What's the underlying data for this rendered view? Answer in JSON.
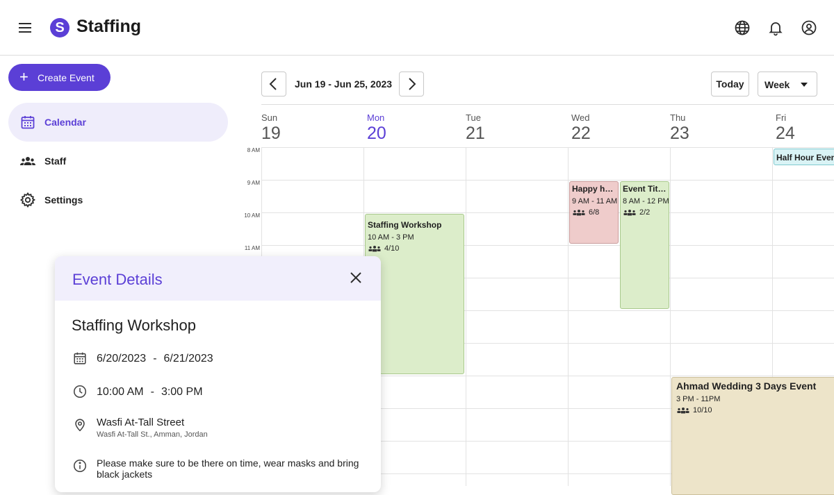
{
  "app": {
    "title": "Staffing",
    "logo_letter": "S"
  },
  "sidebar": {
    "create_label": "Create Event",
    "items": [
      {
        "label": "Calendar",
        "icon": "calendar-icon",
        "active": true
      },
      {
        "label": "Staff",
        "icon": "people-icon",
        "active": false
      },
      {
        "label": "Settings",
        "icon": "gear-icon",
        "active": false
      }
    ]
  },
  "toolbar": {
    "range": "Jun 19 - Jun 25, 2023",
    "today_label": "Today",
    "view_label": "Week"
  },
  "days": [
    {
      "name": "Sun",
      "num": "19",
      "current": false
    },
    {
      "name": "Mon",
      "num": "20",
      "current": true
    },
    {
      "name": "Tue",
      "num": "21",
      "current": false
    },
    {
      "name": "Wed",
      "num": "22",
      "current": false
    },
    {
      "name": "Thu",
      "num": "23",
      "current": false
    },
    {
      "name": "Fri",
      "num": "24",
      "current": false
    }
  ],
  "hours": [
    "8 AM",
    "9 AM",
    "10 AM",
    "11 AM"
  ],
  "events": [
    {
      "title": "Half Hour Event",
      "time": "",
      "count": "",
      "color": "#d9f3f5",
      "border": "#7fc9cf"
    },
    {
      "title": "Happy hou...",
      "time": "9 AM - 11 AM",
      "count": "6/8",
      "color": "#efcccb",
      "border": "#c99d9c"
    },
    {
      "title": "Event Title...",
      "time": "8 AM - 12 PM",
      "count": "2/2",
      "color": "#dcedca",
      "border": "#a8c98c"
    },
    {
      "title": "Staffing Workshop",
      "time": "10 AM - 3 PM",
      "count": "4/10",
      "color": "#dcedca",
      "border": "#a8c98c"
    },
    {
      "title": "Ahmad Wedding 3 Days Event",
      "time": "3 PM - 11PM",
      "count": "10/10",
      "color": "#ede4c9",
      "border": "#cbbf9b"
    }
  ],
  "details": {
    "header": "Event Details",
    "name": "Staffing Workshop",
    "start_date": "6/20/2023",
    "end_date": "6/21/2023",
    "date_sep": "-",
    "start_time": "10:00 AM",
    "end_time": "3:00 PM",
    "time_sep": "-",
    "location": "Wasfi At-Tall Street",
    "address": "Wasfi At-Tall St., Amman, Jordan",
    "note": "Please make sure to be there on time, wear masks and bring black jackets"
  },
  "colors": {
    "accent": "#5b3fd6",
    "accent_light": "#efedfb"
  }
}
